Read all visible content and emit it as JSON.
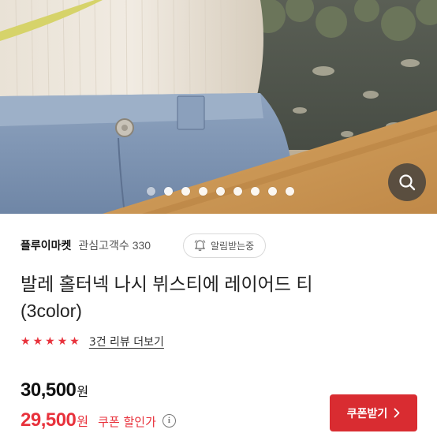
{
  "gallery": {
    "image_count": 9,
    "active_index": 0,
    "zoom_icon": "search-icon"
  },
  "seller": {
    "name": "플루이마켓",
    "watchers": "관심고객수 330"
  },
  "alarm": {
    "label": "알림받는중",
    "icon": "bell-icon"
  },
  "product": {
    "title_line1": "발레 홀터넥 나시 뷔스티에 레이어드 티",
    "title_line2": "(3color)"
  },
  "rating": {
    "stars": 5,
    "review_link": "3건 리뷰 더보기"
  },
  "pricing": {
    "price": "30,500",
    "currency": "원",
    "sale_price": "29,500",
    "coupon_text": "쿠폰 할인가",
    "info_glyph": "i"
  },
  "coupon_button": {
    "label": "쿠폰받기",
    "icon": "chevron-right-icon"
  },
  "colors": {
    "accent_red": "#e8323c",
    "button_red": "#d92c31"
  }
}
